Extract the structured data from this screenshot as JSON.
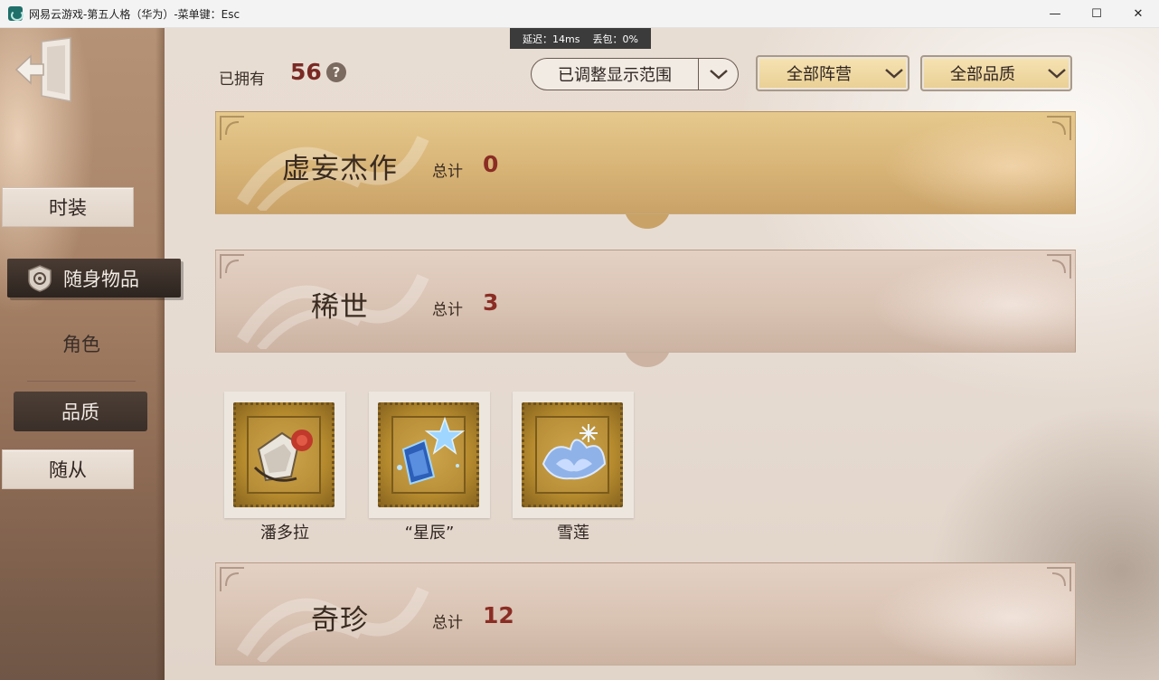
{
  "window": {
    "title": "网易云游戏-第五人格（华为）-菜单键：Esc",
    "minimize": "—",
    "maximize": "☐",
    "close": "✕"
  },
  "network": {
    "latency": "延迟：14ms",
    "packet_loss": "丢包：0%"
  },
  "sidebar": {
    "items": [
      {
        "label": "时装",
        "state": "normal"
      },
      {
        "label": "随身物品",
        "state": "selected",
        "icon": "emblem-icon"
      },
      {
        "label": "角色",
        "state": "text"
      },
      {
        "label": "品质",
        "state": "selected-filter"
      },
      {
        "label": "随从",
        "state": "normal"
      }
    ]
  },
  "header": {
    "owned_label": "已拥有",
    "owned_count": "56",
    "help": "?"
  },
  "filters": {
    "range": "已调整显示范围",
    "faction": "全部阵营",
    "quality": "全部品质"
  },
  "categories": [
    {
      "name": "虚妄杰作",
      "total_label": "总计",
      "count": "0",
      "style": "gold"
    },
    {
      "name": "稀世",
      "total_label": "总计",
      "count": "3",
      "style": "rose"
    },
    {
      "name": "奇珍",
      "total_label": "总计",
      "count": "12",
      "style": "rose"
    }
  ],
  "items": [
    {
      "name": "潘多拉",
      "icon": "pandora-box-rose-icon"
    },
    {
      "name": "“星辰”",
      "icon": "star-crystal-icon"
    },
    {
      "name": "雪莲",
      "icon": "snow-lotus-icon"
    }
  ],
  "colors": {
    "accent_red": "#8a2d24",
    "gold_banner": "#d8b477",
    "rose_banner": "#d9c3b3",
    "selected_nav": "#2c241f"
  }
}
